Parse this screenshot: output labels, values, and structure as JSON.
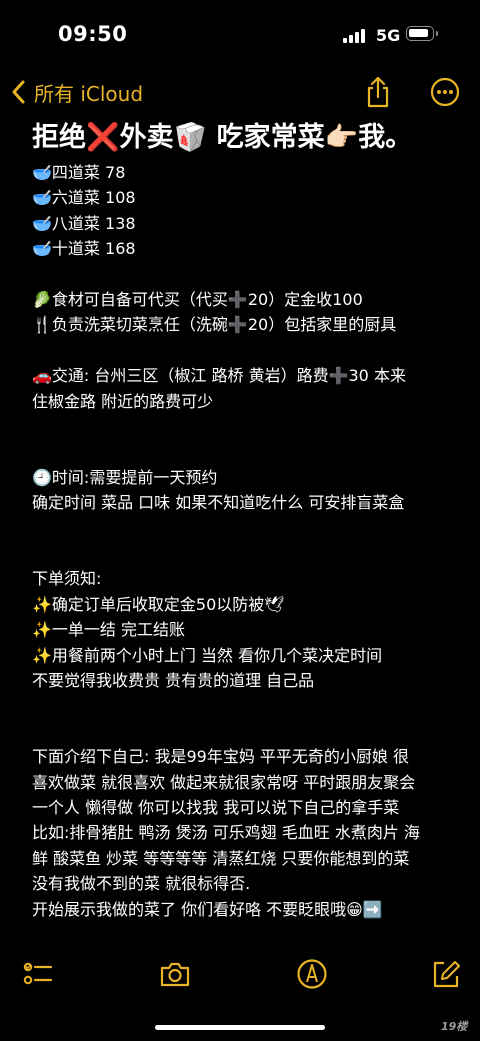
{
  "status": {
    "time": "09:50",
    "network": "5G"
  },
  "nav": {
    "back_label": "所有 iCloud"
  },
  "note": {
    "title": "拒绝❌外卖🥡 吃家常菜👉🏻我。",
    "lines": [
      "🥣四道菜 78",
      "🥣六道菜 108",
      "🥣八道菜 138",
      "🥣十道菜 168",
      "",
      "🥬食材可自备可代买（代买➕20）定金收100",
      "🍴负责洗菜切菜烹任（洗碗➕20）包括家里的厨具",
      "",
      "🚗交通: 台州三区（椒江 路桥 黄岩）路费➕30 本来",
      "住椒金路 附近的路费可少",
      "",
      "",
      "🕘时间:需要提前一天预约",
      "确定时间 菜品 口味 如果不知道吃什么 可安排盲菜盒",
      "",
      "",
      "下单须知:",
      "✨确定订单后收取定金50以防被🕊",
      "✨一单一结 完工结账",
      "✨用餐前两个小时上门 当然 看你几个菜决定时间",
      "不要觉得我收费贵 贵有贵的道理 自己品",
      "",
      "",
      "下面介绍下自己: 我是99年宝妈 平平无奇的小厨娘 很",
      "喜欢做菜 就很喜欢 做起来就很家常呀 平时跟朋友聚会",
      "一个人 懒得做 你可以找我 我可以说下自己的拿手菜",
      "比如:排骨猪肚 鸭汤 煲汤 可乐鸡翅 毛血旺 水煮肉片 海",
      "鲜 酸菜鱼 炒菜 等等等等 清蒸红烧 只要你能想到的菜",
      "没有我做不到的菜 就很标得否.",
      "开始展示我做的菜了 你们看好咯 不要眨眼哦😁➡️"
    ]
  },
  "watermark": "19楼",
  "colors": {
    "accent": "#e8b325",
    "background": "#000000",
    "text": "#ffffff"
  },
  "icons": [
    "back-chevron-icon",
    "share-icon",
    "more-icon",
    "checklist-icon",
    "camera-icon",
    "markup-pen-icon",
    "compose-icon"
  ]
}
